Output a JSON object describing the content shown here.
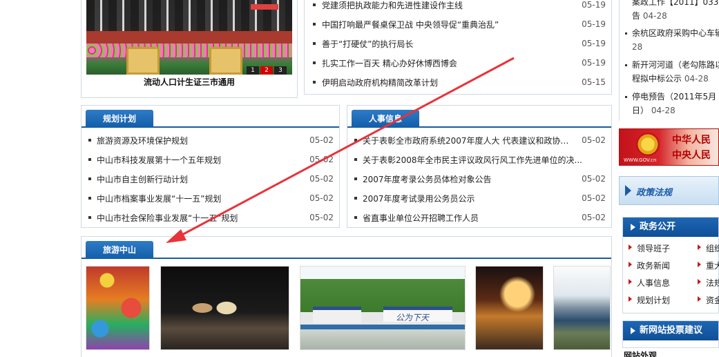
{
  "slideshow": {
    "caption": "流动人口计生证三市通用",
    "pages": [
      "1",
      "2",
      "3"
    ],
    "active_page": 2
  },
  "top_news": [
    {
      "title": "党建须把执政能力和先进性建设作主线",
      "date": "05-19"
    },
    {
      "title": "中国打响最严餐桌保卫战 中央领导促“重典治乱”",
      "date": "05-19"
    },
    {
      "title": "善于“打硬仗”的执行局长",
      "date": "05-19"
    },
    {
      "title": "扎实工作一百天 精心办好休博西博会",
      "date": "05-19"
    },
    {
      "title": "伊明启动政府机构精简改革计划",
      "date": "05-15"
    }
  ],
  "plan_panel": {
    "title": "规划计划",
    "items": [
      {
        "title": "旅游资源及环境保护规划",
        "date": "05-02"
      },
      {
        "title": "中山市科技发展第十一个五年规划",
        "date": "05-02"
      },
      {
        "title": "中山市自主创新行动计划",
        "date": "05-02"
      },
      {
        "title": "中山市档案事业发展“十一五”规划",
        "date": "05-02"
      },
      {
        "title": "中山市社会保险事业发展“十一五”规划",
        "date": "05-02"
      }
    ]
  },
  "hr_panel": {
    "title": "人事信息",
    "items": [
      {
        "title": "关于表彰全市政府系统2007年度人大 代表建议和政协提...",
        "date": "05-02"
      },
      {
        "title": "关于表彰2008年全市民主评议政风行风工作先进单位的决...",
        "date": ""
      },
      {
        "title": "2007年度考录公务员体检对象公告",
        "date": "05-02"
      },
      {
        "title": "2007年度考试录用公务员公示",
        "date": "05-02"
      },
      {
        "title": "省直事业单位公开招聘工作人员",
        "date": "05-02"
      }
    ]
  },
  "tour_panel": {
    "title": "旅游中山",
    "photo3_sign": "公为下天"
  },
  "right_notices": [
    {
      "line1": "案政工作【2011】033",
      "line2": "告",
      "date": "04-28"
    },
    {
      "line1": "余杭区政府采购中心车辆",
      "line2": "",
      "date": "28"
    },
    {
      "line1": "新开河河道（老勾陈路以",
      "line2": "程拟中标公示",
      "date": "04-28"
    },
    {
      "line1": "停电预告（2011年5月",
      "line2": "日）",
      "date": "04-28"
    }
  ],
  "gov_banner": {
    "line1": "中华人民",
    "line2": "中央人民",
    "url": "WWW.GOV.cn"
  },
  "policy_banner": {
    "label": "政策法规"
  },
  "gov_open": {
    "title": "政务公开",
    "items": [
      "领导班子",
      "组织",
      "政务新闻",
      "重大",
      "人事信息",
      "法规",
      "规划计划",
      "资金"
    ]
  },
  "vote_box": {
    "title": "新网站投票建议"
  },
  "survey": {
    "label": "网站外观"
  },
  "colors": {
    "tab_blue": "#145ea8",
    "arrow_red": "#e8333a",
    "pager_active": "#d10000"
  }
}
